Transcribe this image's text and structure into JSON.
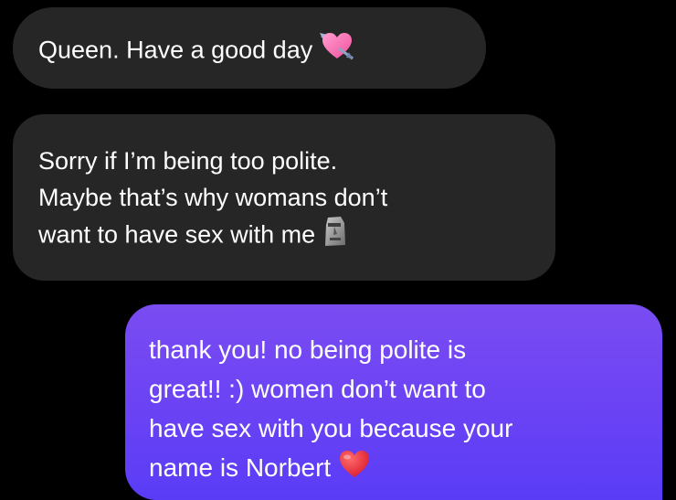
{
  "conversation": {
    "messages": [
      {
        "direction": "incoming",
        "lines": [
          "Queen. Have a good day"
        ],
        "emoji": "heart-with-arrow-icon"
      },
      {
        "direction": "incoming",
        "lines": [
          "Sorry if I’m being too polite.",
          "Maybe that’s why womans don’t",
          "want to have sex with me"
        ],
        "emoji": "moai-icon"
      },
      {
        "direction": "outgoing",
        "lines": [
          "thank you! no being polite is",
          "great!! :) women don’t want to",
          "have sex with you because your",
          "name is Norbert"
        ],
        "emoji": "red-heart-icon"
      }
    ]
  },
  "colors": {
    "background": "#000000",
    "incoming_bubble": "#262626",
    "outgoing_bubble": "#6d44f4",
    "text": "#ffffff"
  }
}
